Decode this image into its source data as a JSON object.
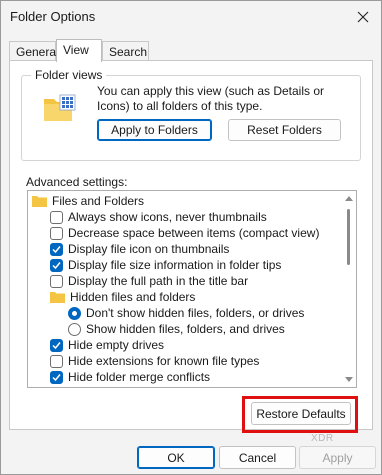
{
  "window": {
    "title": "Folder Options"
  },
  "tabs": [
    {
      "label": "General",
      "active": false
    },
    {
      "label": "View",
      "active": true
    },
    {
      "label": "Search",
      "active": false
    }
  ],
  "folder_views": {
    "title": "Folder views",
    "description": "You can apply this view (such as Details or Icons) to all folders of this type.",
    "apply_label": "Apply to Folders",
    "reset_label": "Reset Folders"
  },
  "advanced": {
    "label": "Advanced settings:",
    "items": [
      {
        "kind": "folder",
        "label": "Files and Folders"
      },
      {
        "kind": "checkbox",
        "label": "Always show icons, never thumbnails",
        "checked": false
      },
      {
        "kind": "checkbox",
        "label": "Decrease space between items (compact view)",
        "checked": false
      },
      {
        "kind": "checkbox",
        "label": "Display file icon on thumbnails",
        "checked": true
      },
      {
        "kind": "checkbox",
        "label": "Display file size information in folder tips",
        "checked": true
      },
      {
        "kind": "checkbox",
        "label": "Display the full path in the title bar",
        "checked": false
      },
      {
        "kind": "folder",
        "label": "Hidden files and folders"
      },
      {
        "kind": "radio",
        "label": "Don't show hidden files, folders, or drives",
        "checked": true
      },
      {
        "kind": "radio",
        "label": "Show hidden files, folders, and drives",
        "checked": false
      },
      {
        "kind": "checkbox",
        "label": "Hide empty drives",
        "checked": true
      },
      {
        "kind": "checkbox",
        "label": "Hide extensions for known file types",
        "checked": false
      },
      {
        "kind": "checkbox",
        "label": "Hide folder merge conflicts",
        "checked": true
      }
    ]
  },
  "restore_defaults_label": "Restore Defaults",
  "watermark": "XDR",
  "footer": {
    "ok_label": "OK",
    "cancel_label": "Cancel",
    "apply_label": "Apply"
  },
  "colors": {
    "accent": "#0067c0",
    "folder": "#f4c542",
    "highlight": "#e01010"
  }
}
